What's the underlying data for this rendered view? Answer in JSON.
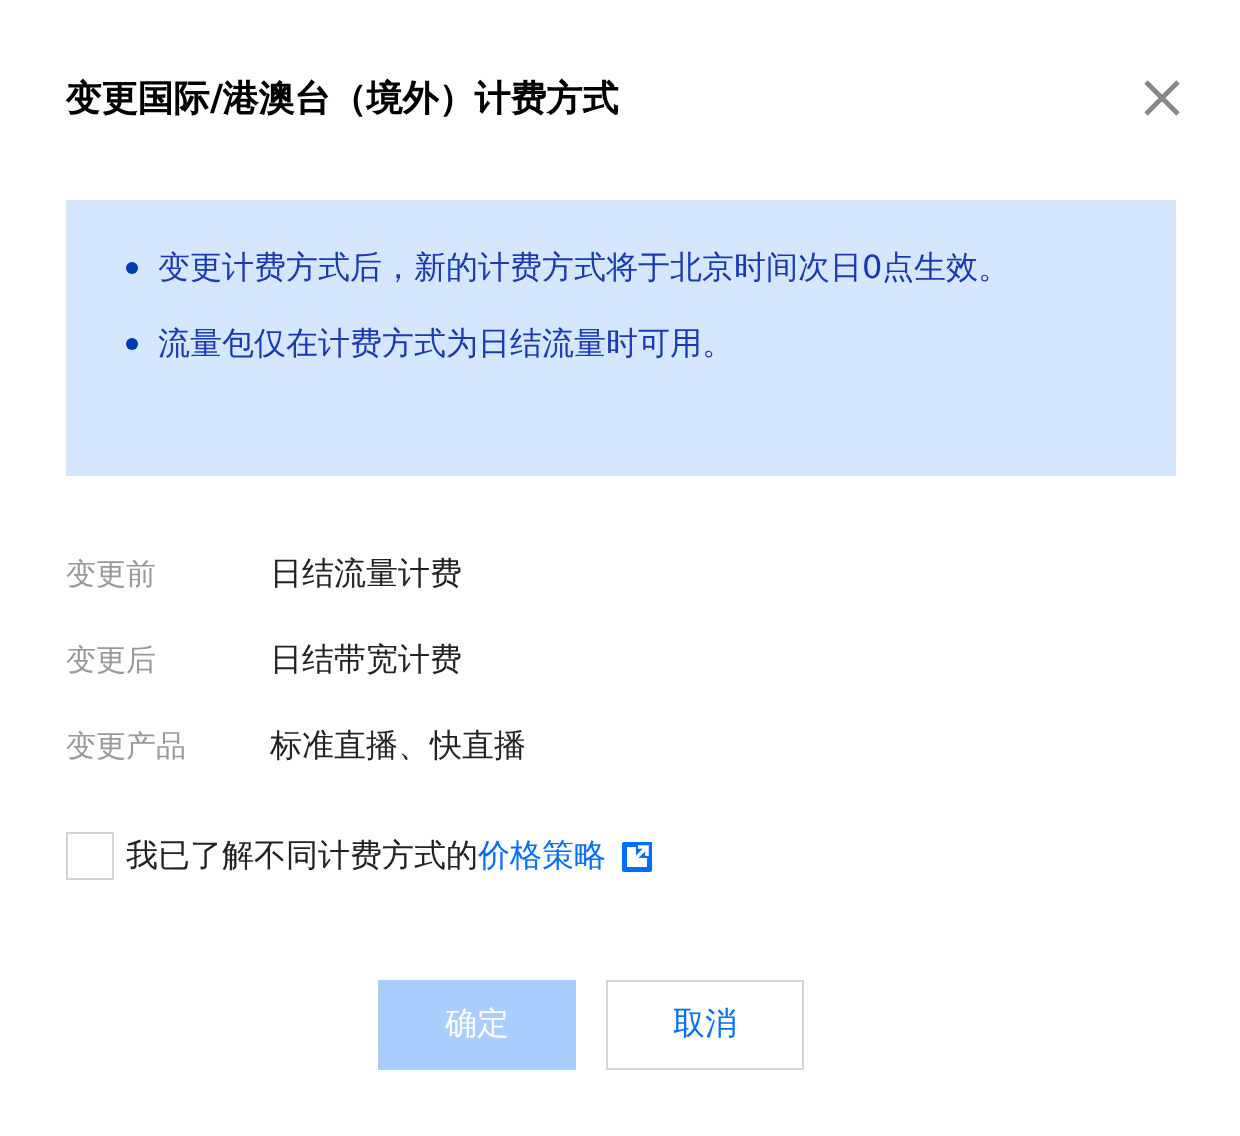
{
  "dialog": {
    "title": "变更国际/港澳台（境外）计费方式"
  },
  "notice": [
    "变更计费方式后，新的计费方式将于北京时间次日0点生效。",
    "流量包仅在计费方式为日结流量时可用。"
  ],
  "details": [
    {
      "label": "变更前",
      "value": "日结流量计费"
    },
    {
      "label": "变更后",
      "value": "日结带宽计费"
    },
    {
      "label": "变更产品",
      "value": "标准直播、快直播"
    }
  ],
  "agreement": {
    "checked": false,
    "text": "我已了解不同计费方式的",
    "link": "价格策略"
  },
  "buttons": [
    {
      "label": "确定",
      "kind": "primary",
      "disabled": true
    },
    {
      "label": "取消",
      "kind": "secondary",
      "disabled": false
    }
  ]
}
